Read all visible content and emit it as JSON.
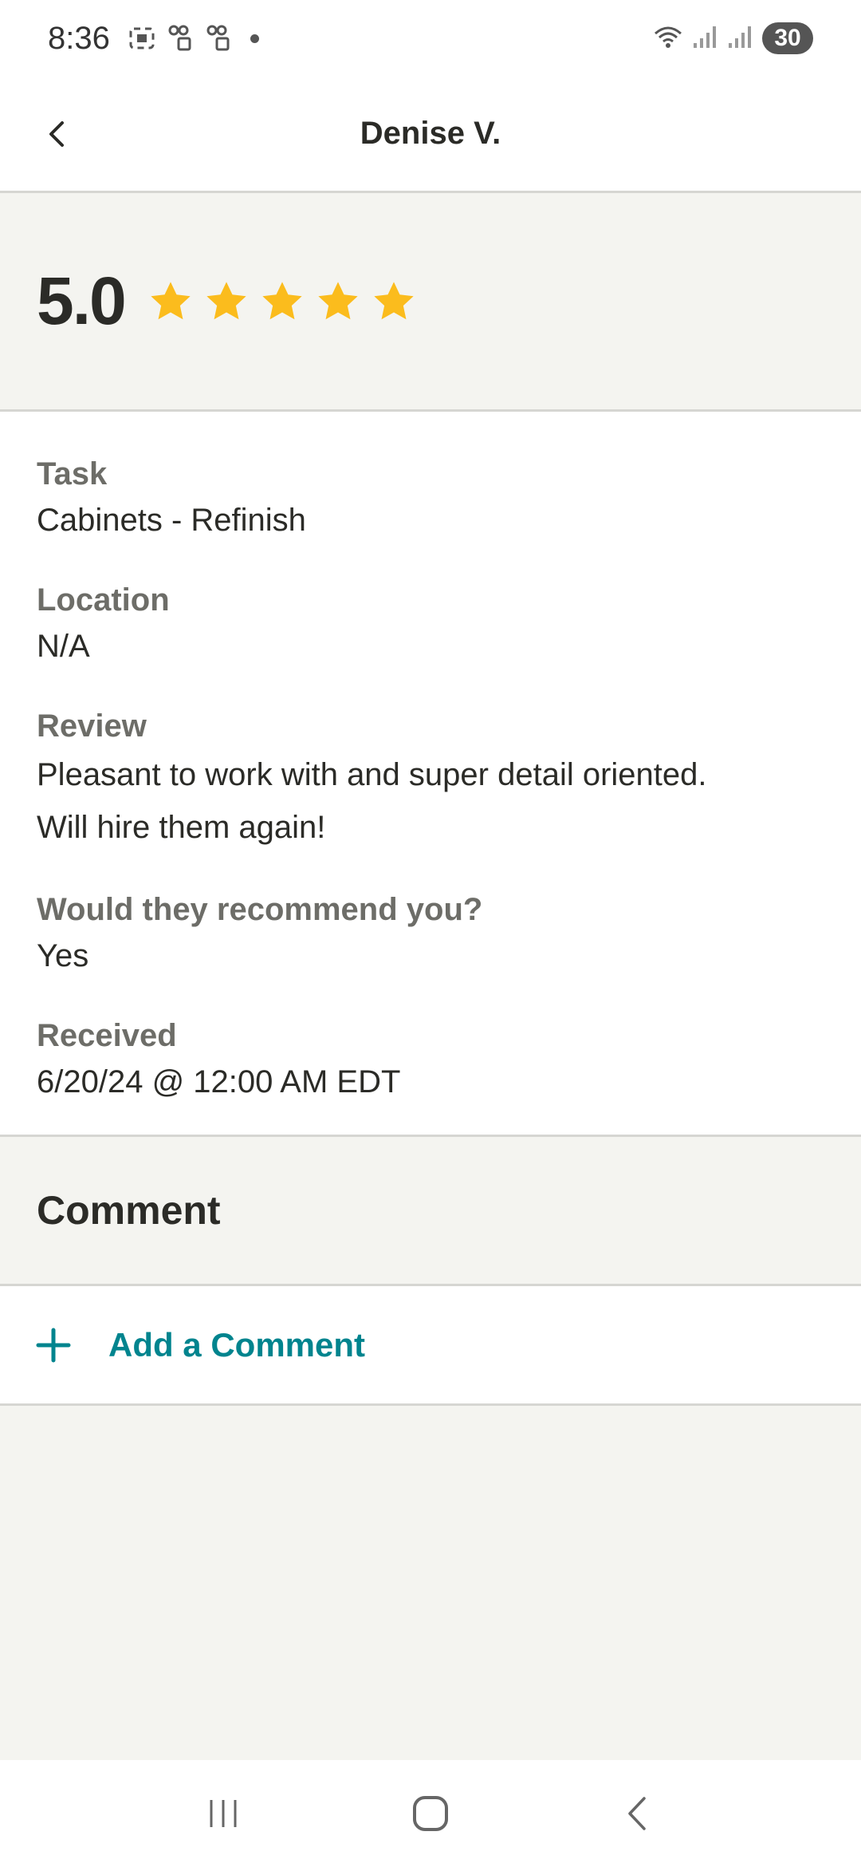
{
  "status_bar": {
    "time": "8:36",
    "battery": "30",
    "icons": [
      "screenshot-icon",
      "vpn-key-icon",
      "vpn-key-icon",
      "notification-dot",
      "wifi-icon",
      "signal-icon",
      "signal-icon",
      "battery-icon"
    ]
  },
  "header": {
    "title": "Denise V.",
    "back_icon": "chevron-left-icon"
  },
  "rating": {
    "value": "5.0",
    "stars": 5,
    "max_stars": 5,
    "star_color": "#fbbc1d"
  },
  "details": {
    "task_label": "Task",
    "task_value": "Cabinets - Refinish",
    "location_label": "Location",
    "location_value": "N/A",
    "review_label": "Review",
    "review_value_line1": "Pleasant to work with and super detail oriented.",
    "review_value_line2": "Will hire them again!",
    "recommend_label": "Would they recommend you?",
    "recommend_value": "Yes",
    "received_label": "Received",
    "received_value": "6/20/24 @ 12:00 AM EDT"
  },
  "comment_section": {
    "title": "Comment",
    "add_label": "Add a Comment",
    "add_icon": "plus-icon",
    "accent": "#00848e"
  },
  "nav": {
    "icons": [
      "recent-apps-icon",
      "home-icon",
      "back-icon"
    ]
  }
}
